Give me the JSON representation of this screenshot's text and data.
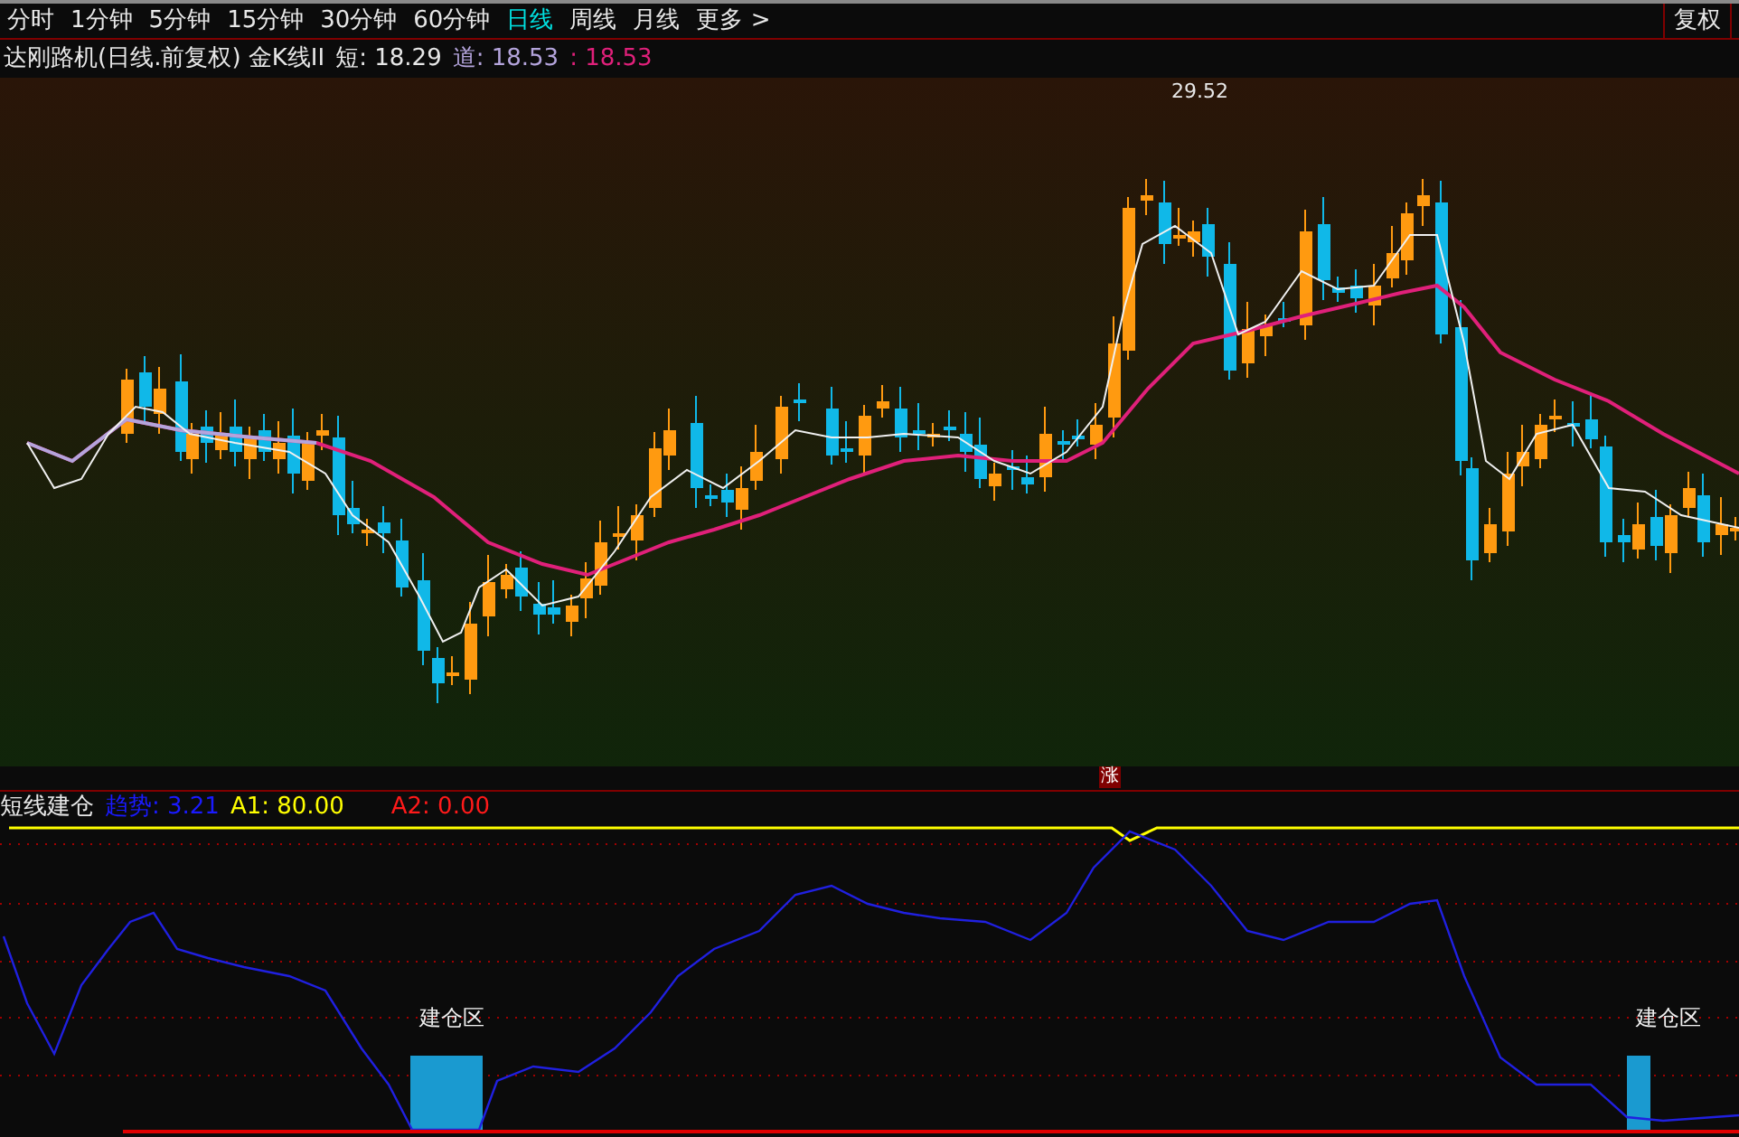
{
  "tabs": [
    {
      "label": "分时",
      "selected": false
    },
    {
      "label": "1分钟",
      "selected": false
    },
    {
      "label": "5分钟",
      "selected": false
    },
    {
      "label": "15分钟",
      "selected": false
    },
    {
      "label": "30分钟",
      "selected": false
    },
    {
      "label": "60分钟",
      "selected": false
    },
    {
      "label": "日线",
      "selected": true
    },
    {
      "label": "周线",
      "selected": false
    },
    {
      "label": "月线",
      "selected": false
    },
    {
      "label": "更多 >",
      "selected": false
    }
  ],
  "restore_button": "复权",
  "main_chart": {
    "title": "达刚路机(日线.前复权) 金K线II",
    "legend": [
      {
        "text": "短: 18.29",
        "kind": "short"
      },
      {
        "text": "道: 18.53",
        "kind": "medium"
      },
      {
        "text": ": 18.53",
        "kind": "long"
      }
    ],
    "peak_label": "29.52",
    "badge": "涨"
  },
  "indicator": {
    "title": "短线建仓",
    "legend": [
      {
        "text": "趋势: 3.21",
        "color": "#1a1aff"
      },
      {
        "text": "A1: 80.00",
        "color": "#ffff00"
      },
      {
        "text": "A2: 0.00",
        "color": "#ff1a1a"
      }
    ],
    "zone_labels": [
      "建仓区",
      "建仓区"
    ]
  }
}
